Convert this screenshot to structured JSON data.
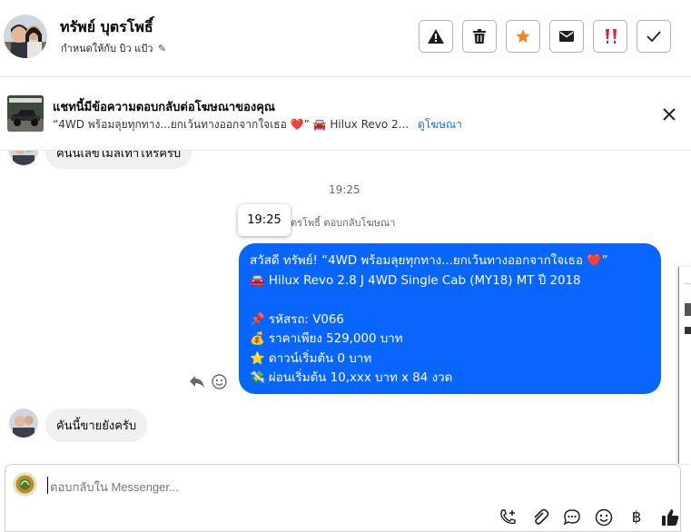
{
  "header": {
    "contact_name": "ทรัพย์ บุตรโพธิ์",
    "assign_label": "กำหนดให้กับ บิว แป้ว",
    "buttons": [
      {
        "name": "report",
        "icon": "warning-icon"
      },
      {
        "name": "delete",
        "icon": "trash-icon"
      },
      {
        "name": "star",
        "icon": "star-icon"
      },
      {
        "name": "mark-unread",
        "icon": "envelope-icon"
      },
      {
        "name": "important",
        "icon": "double-exclamation-icon"
      },
      {
        "name": "done",
        "icon": "checkmark-icon"
      }
    ]
  },
  "ad_banner": {
    "title": "แชทนี้มีข้อความตอบกลับต่อโฆษณาของคุณ",
    "preview": "“4WD พร้อมลุยทุกทาง...ยกเว้นทางออกจากใจเธอ ❤️” 🚘 Hilux Revo 2...",
    "view_ad_link": "ดูโฆษณา"
  },
  "messages": {
    "prev_incoming": "คันนี้เลขไมล์เท่าไหร่ครับ",
    "timestamp": "19:25",
    "tooltip_time": "19:25",
    "reply_context": "ตรโพธิ์ ตอบกลับโฆษณา",
    "outgoing_lines": [
      "สวัสดี ทรัพย์! “4WD พร้อมลุยทุกทาง...ยกเว้นทางออกจากใจเธอ ❤️”",
      "🚘 Hilux Revo 2.8 J 4WD Single Cab (MY18) MT ปี 2018",
      "",
      "📌 รหัสรถ: V066",
      "💰 ราคาเพียง 529,000 บาท",
      "⭐ ดาวน์เริ่มต้น 0 บาท",
      "💸 ผ่อนเริ่มต้น 10,xxx บาท x 84 งวด"
    ],
    "last_incoming": "คันนี้ขายยังครับ"
  },
  "composer": {
    "placeholder": "ตอบกลับใน Messenger...",
    "value": "",
    "tools": [
      "call-add-icon",
      "attachment-icon",
      "saved-replies-icon",
      "emoji-icon",
      "baht-icon",
      "thumbs-up-icon"
    ]
  },
  "colors": {
    "outgoing_bubble": "#0866ff",
    "incoming_bubble": "#f0f0f0",
    "star": "#f5811f",
    "important": "#e41e3f",
    "link": "#1a6ed8"
  }
}
